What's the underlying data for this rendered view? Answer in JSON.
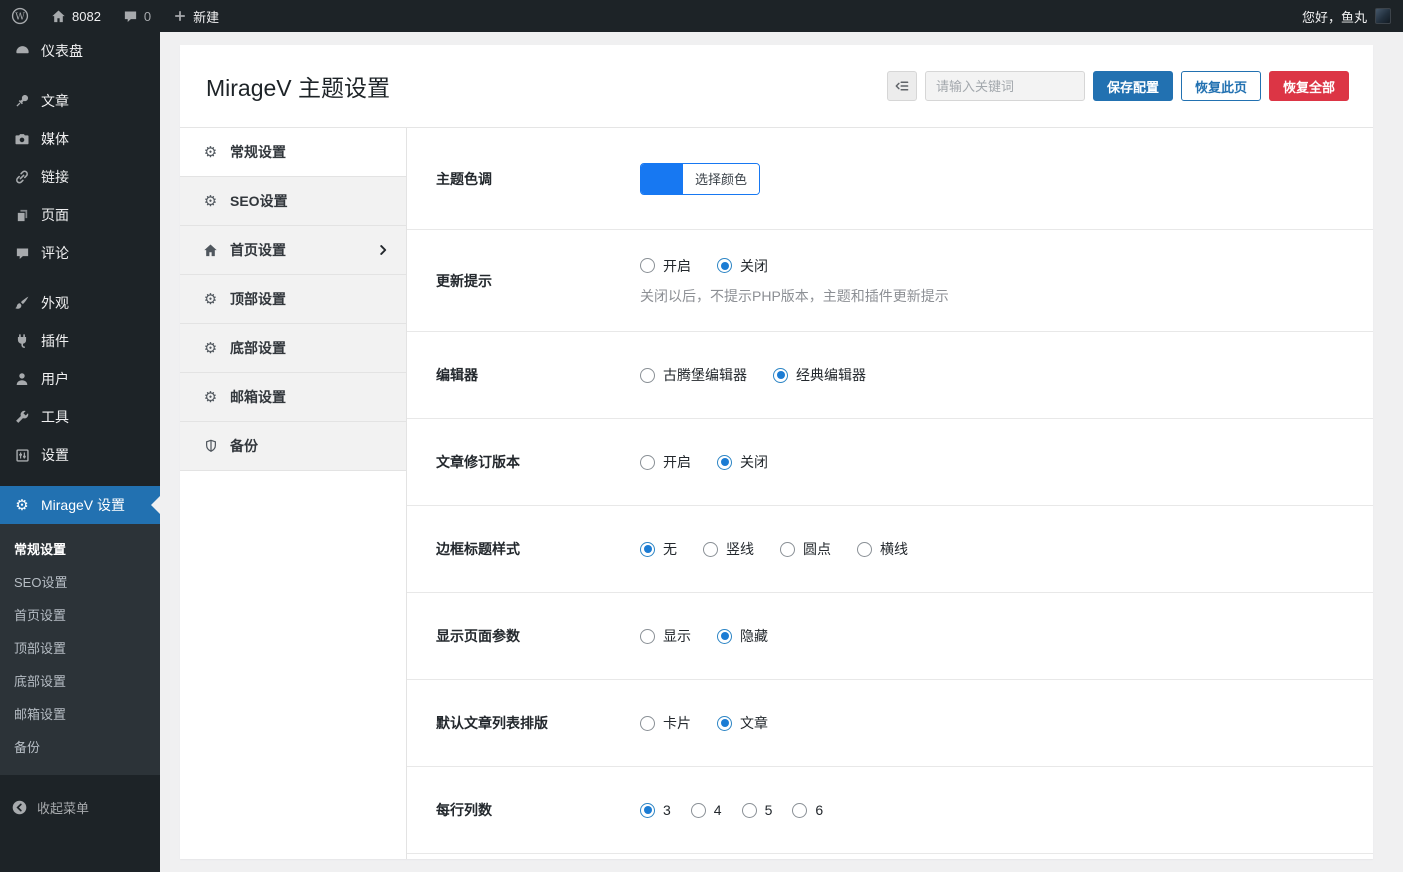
{
  "adminbar": {
    "site_name": "8082",
    "comment_count": "0",
    "new_label": "新建",
    "greeting": "您好，鱼丸"
  },
  "sidebar": {
    "items": [
      {
        "label": "仪表盘"
      },
      {
        "label": "文章"
      },
      {
        "label": "媒体"
      },
      {
        "label": "链接"
      },
      {
        "label": "页面"
      },
      {
        "label": "评论"
      },
      {
        "label": "外观"
      },
      {
        "label": "插件"
      },
      {
        "label": "用户"
      },
      {
        "label": "工具"
      },
      {
        "label": "设置"
      },
      {
        "label": "MirageV 设置",
        "active": true
      }
    ],
    "submenu": [
      {
        "label": "常规设置",
        "current": true
      },
      {
        "label": "SEO设置"
      },
      {
        "label": "首页设置"
      },
      {
        "label": "顶部设置"
      },
      {
        "label": "底部设置"
      },
      {
        "label": "邮箱设置"
      },
      {
        "label": "备份"
      }
    ],
    "collapse_label": "收起菜单"
  },
  "header": {
    "title": "MirageV 主题设置",
    "search_placeholder": "请输入关键词",
    "save_label": "保存配置",
    "restore_page_label": "恢复此页",
    "restore_all_label": "恢复全部"
  },
  "tabs": [
    {
      "label": "常规设置",
      "active": true
    },
    {
      "label": "SEO设置"
    },
    {
      "label": "首页设置",
      "has_children": true
    },
    {
      "label": "顶部设置"
    },
    {
      "label": "底部设置"
    },
    {
      "label": "邮箱设置"
    },
    {
      "label": "备份"
    }
  ],
  "settings": {
    "rows": [
      {
        "label": "主题色调",
        "type": "color",
        "button_label": "选择颜色",
        "color": "#1778f2"
      },
      {
        "label": "更新提示",
        "type": "radio",
        "options": [
          {
            "label": "开启",
            "checked": false
          },
          {
            "label": "关闭",
            "checked": true
          }
        ],
        "description": "关闭以后，不提示PHP版本，主题和插件更新提示"
      },
      {
        "label": "编辑器",
        "type": "radio",
        "options": [
          {
            "label": "古腾堡编辑器",
            "checked": false
          },
          {
            "label": "经典编辑器",
            "checked": true
          }
        ]
      },
      {
        "label": "文章修订版本",
        "type": "radio",
        "options": [
          {
            "label": "开启",
            "checked": false
          },
          {
            "label": "关闭",
            "checked": true
          }
        ]
      },
      {
        "label": "边框标题样式",
        "type": "radio",
        "options": [
          {
            "label": "无",
            "checked": true
          },
          {
            "label": "竖线",
            "checked": false
          },
          {
            "label": "圆点",
            "checked": false
          },
          {
            "label": "横线",
            "checked": false
          }
        ]
      },
      {
        "label": "显示页面参数",
        "type": "radio",
        "options": [
          {
            "label": "显示",
            "checked": false
          },
          {
            "label": "隐藏",
            "checked": true
          }
        ]
      },
      {
        "label": "默认文章列表排版",
        "type": "radio",
        "options": [
          {
            "label": "卡片",
            "checked": false
          },
          {
            "label": "文章",
            "checked": true
          }
        ]
      },
      {
        "label": "每行列数",
        "type": "radio",
        "options": [
          {
            "label": "3",
            "checked": true
          },
          {
            "label": "4",
            "checked": false
          },
          {
            "label": "5",
            "checked": false
          },
          {
            "label": "6",
            "checked": false
          }
        ]
      }
    ]
  },
  "colors": {
    "accent": "#2271b1",
    "theme_blue": "#1778f2",
    "danger": "#dc3545"
  }
}
